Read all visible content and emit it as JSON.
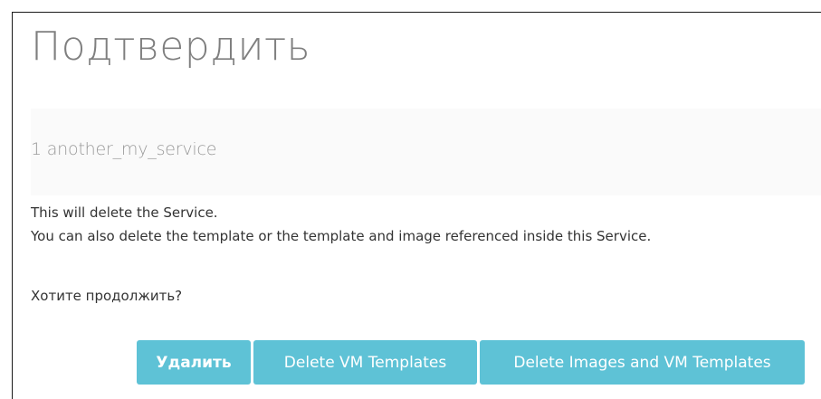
{
  "dialog": {
    "title": "Подтвердить",
    "service_item": "1 another_my_service",
    "message_line1": "This will delete the Service.",
    "message_line2": "You can also delete the template or the template and image referenced inside this Service.",
    "question": "Хотите продолжить?",
    "buttons": {
      "delete": "Удалить",
      "delete_vm_templates": "Delete VM Templates",
      "delete_images_vm_templates": "Delete Images and VM Templates"
    }
  },
  "colors": {
    "button": "#5ec2d6",
    "title": "#7f7f7f"
  }
}
